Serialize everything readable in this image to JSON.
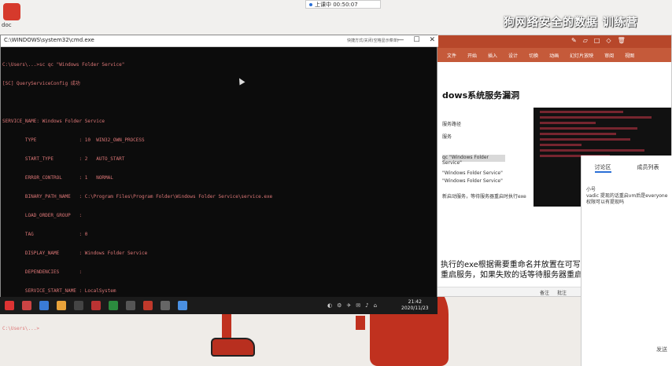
{
  "desktop": {
    "icon_label": "doc",
    "watermark": "狗网络安全的数据  训练营",
    "timer": "上课中 00:50:07"
  },
  "cmd": {
    "title": "C:\\WINDOWS\\system32\\cmd.exe",
    "header_tag": "快捷方式/关闭(空格显示菜单)",
    "lines": [
      "C:\\Users\\...>sc qc \"Windows Folder Service\"",
      "[SC] QueryServiceConfig 成功",
      "",
      "SERVICE_NAME: Windows Folder Service",
      "        TYPE               : 10  WIN32_OWN_PROCESS",
      "        START_TYPE         : 2   AUTO_START",
      "        ERROR_CONTROL      : 1   NORMAL",
      "        BINARY_PATH_NAME   : C:\\Program Files\\Program Folder\\Windows Folder Service\\service.exe",
      "        LOAD_ORDER_GROUP   :",
      "        TAG                : 0",
      "        DISPLAY_NAME       : Windows Folder Service",
      "        DEPENDENCIES       :",
      "        SERVICE_START_NAME : LocalSystem",
      "",
      "C:\\Users\\...>"
    ]
  },
  "taskbar": {
    "clock_time": "21:42",
    "clock_date": "2020/11/23"
  },
  "ppt": {
    "ribbon": [
      "文件",
      "开始",
      "插入",
      "设计",
      "切换",
      "动画",
      "幻灯片放映",
      "审阅",
      "视图",
      "帮助",
      "操作说明搜索"
    ],
    "slide_title": "dows系统服务漏洞",
    "line1": "服务路径",
    "line2": "服务",
    "line3": "qc \"Windows Folder Service\"",
    "line4": "\"Windows Folder Service\"",
    "line5": "\"Windows Folder Service\"",
    "line6": "新启动服务，等待服务器重启时执行exe",
    "big1": "执行的exe根据需要重命名并放置在可写入",
    "big2": "重启服务，如果失败的话等待服务器重启",
    "bottom": [
      "备注",
      "批注"
    ]
  },
  "chat": {
    "tab_active": "讨论区",
    "tab_other": "成员列表",
    "msg_user": "小号",
    "msg_text": "vadic 提现的话重启vm后是everyone权限可以有提现吗",
    "send": "发送"
  },
  "colors": {
    "cmd_bg": "#0c0c0c",
    "ppt_accent": "#b7472a",
    "mascot_red": "#c0311f"
  }
}
